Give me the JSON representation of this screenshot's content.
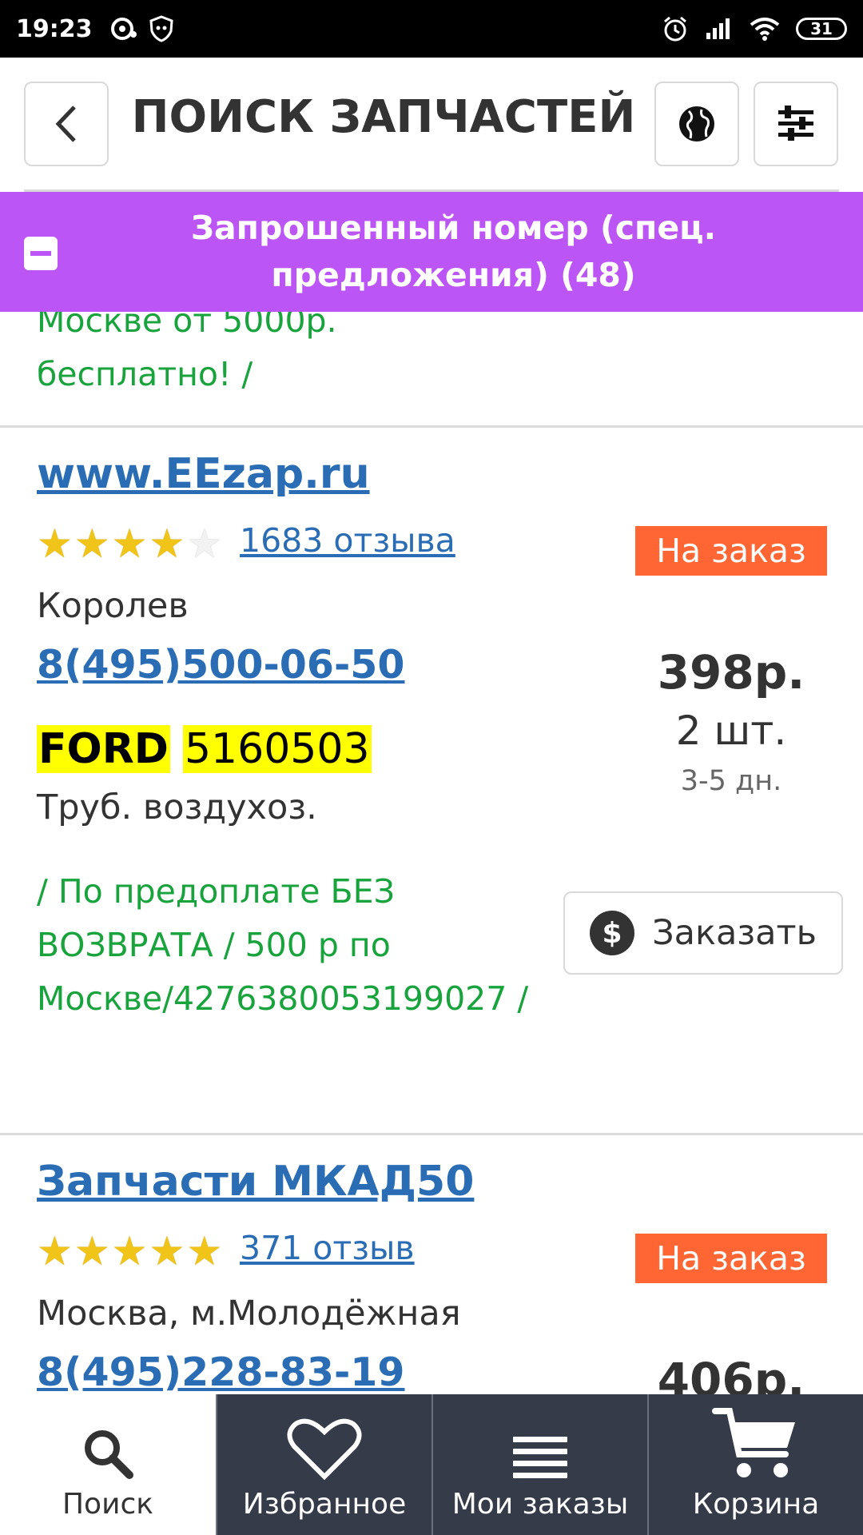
{
  "status_bar": {
    "time": "19:23",
    "battery": "31"
  },
  "header": {
    "title": "ПОИСК ЗАПЧАСТЕЙ"
  },
  "banner": {
    "text": "Запрошенный номер (спец. предложения) (48)"
  },
  "previous_card_note": "Москве от 5000р.\nбесплатно! /",
  "cards": [
    {
      "seller": "www.EEzap.ru",
      "rating": 4,
      "reviews": "1683 отзыва",
      "badge": "На заказ",
      "city": "Королев",
      "phone": "8(495)500-06-50",
      "price": "398р.",
      "qty": "2 шт.",
      "days": "3-5 дн.",
      "brand": "FORD",
      "part_number": "5160503",
      "description": "Труб. воздухоз.",
      "note": "/ По предоплате БЕЗ ВОЗВРАТА / 500 р по Москве/4276380053199027 /",
      "order_label": "Заказать"
    },
    {
      "seller": "Запчасти МКАД50",
      "rating": 5,
      "reviews": "371 отзыв",
      "badge": "На заказ",
      "city": "Москва, м.Молодёжная",
      "phone": "8(495)228-83-19",
      "price": "406р."
    }
  ],
  "bottom_nav": [
    {
      "label": "Поиск",
      "icon": "search-icon",
      "active": true
    },
    {
      "label": "Избранное",
      "icon": "heart-icon",
      "active": false
    },
    {
      "label": "Мои заказы",
      "icon": "list-icon",
      "active": false
    },
    {
      "label": "Корзина",
      "icon": "cart-icon",
      "active": false
    }
  ],
  "colors": {
    "accent_purple": "#bc55f5",
    "badge_orange": "#ff6633",
    "link_blue": "#2a6db5",
    "note_green": "#18a33c",
    "nav_dark": "#353b48"
  }
}
